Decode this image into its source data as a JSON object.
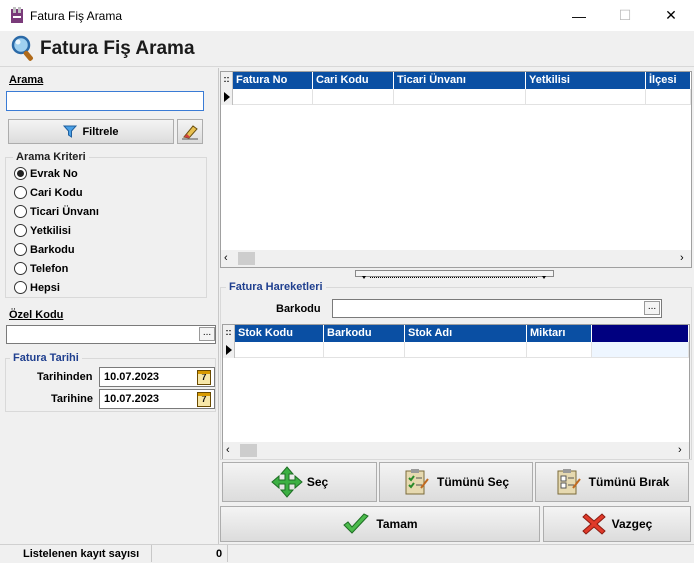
{
  "window": {
    "title": "Fatura Fiş Arama",
    "minimize": "—",
    "maximize": "☐",
    "close": "✕"
  },
  "header": {
    "title": "Fatura Fiş Arama"
  },
  "search": {
    "label": "Arama",
    "value": "",
    "filter_label": "Filtrele"
  },
  "criteria": {
    "title": "Arama Kriteri",
    "options": [
      "Evrak No",
      "Cari Kodu",
      "Ticari Ünvanı",
      "Yetkilisi",
      "Barkodu",
      "Telefon",
      "Hepsi"
    ],
    "selected": "Evrak No"
  },
  "special_code": {
    "label": "Özel Kodu",
    "value": ""
  },
  "invoice_date": {
    "title": "Fatura Tarihi",
    "from_label": "Tarihinden",
    "from_value": "10.07.2023",
    "to_label": "Tarihine",
    "to_value": "10.07.2023",
    "cal_glyph": "7"
  },
  "invoice_grid": {
    "columns": [
      "Fatura No",
      "Cari Kodu",
      "Ticari Ünvanı",
      "Yetkilisi",
      "İlçesi"
    ],
    "indicator": "::"
  },
  "movements": {
    "title": "Fatura Hareketleri",
    "barcode_label": "Barkodu",
    "barcode_value": "",
    "columns": [
      "Stok Kodu",
      "Barkodu",
      "Stok Adı",
      "Miktarı",
      ""
    ]
  },
  "buttons": {
    "select": "Seç",
    "select_all": "Tümünü Seç",
    "deselect_all": "Tümünü Bırak",
    "ok": "Tamam",
    "cancel": "Vazgeç"
  },
  "status": {
    "label": "Listelenen kayıt sayısı",
    "count": "0"
  },
  "colors": {
    "grid_header": "#0a4fa3",
    "dark_header": "#000080"
  }
}
